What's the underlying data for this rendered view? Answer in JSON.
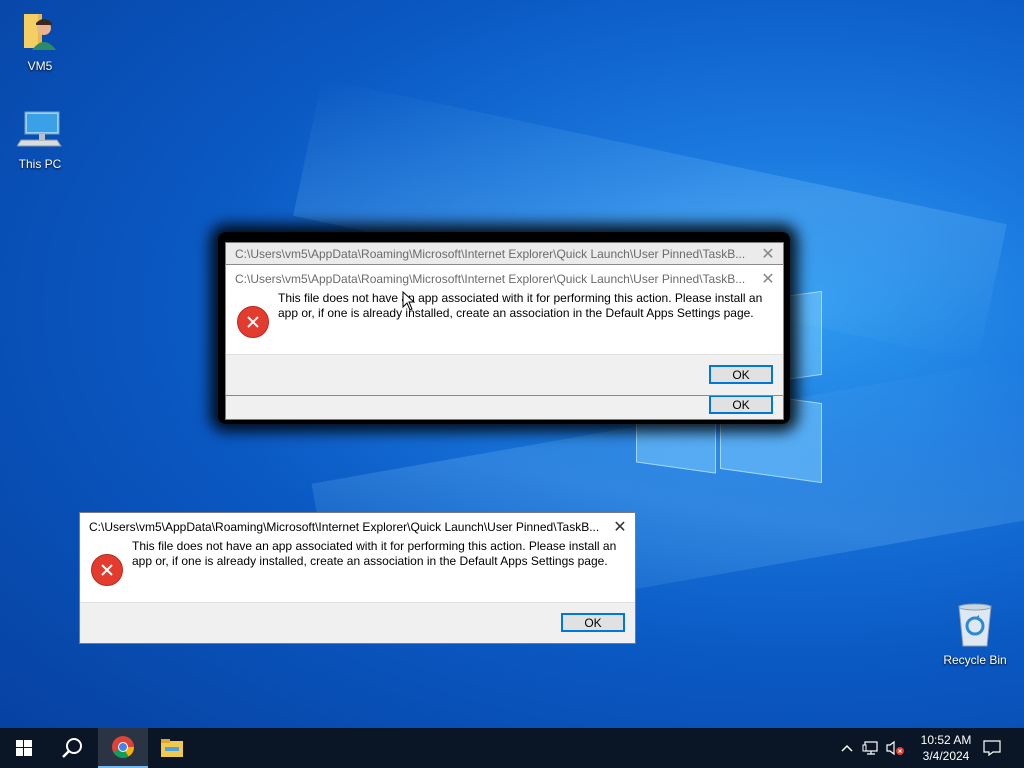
{
  "desktop": {
    "icons": [
      {
        "label": "VM5",
        "icon": "user-folder-icon"
      },
      {
        "label": "This PC",
        "icon": "computer-icon"
      },
      {
        "label": "Recycle Bin",
        "icon": "recycle-bin-icon"
      }
    ]
  },
  "dialogs": {
    "back": {
      "title": "C:\\Users\\vm5\\AppData\\Roaming\\Microsoft\\Internet Explorer\\Quick Launch\\User Pinned\\TaskB...",
      "ok": "OK"
    },
    "front": {
      "title": "C:\\Users\\vm5\\AppData\\Roaming\\Microsoft\\Internet Explorer\\Quick Launch\\User Pinned\\TaskB...",
      "message": "This file does not have an app associated with it for performing this action. Please install an app or, if one is already installed, create an association in the Default Apps Settings page.",
      "ok": "OK"
    },
    "lower": {
      "title": "C:\\Users\\vm5\\AppData\\Roaming\\Microsoft\\Internet Explorer\\Quick Launch\\User Pinned\\TaskB...",
      "message": "This file does not have an app associated with it for performing this action. Please install an app or, if one is already installed, create an association in the Default Apps Settings page.",
      "ok": "OK"
    }
  },
  "taskbar": {
    "items": [
      "start-icon",
      "search-icon",
      "chrome-icon",
      "file-explorer-icon"
    ],
    "tray": [
      "chevron-up-icon",
      "network-icon",
      "volume-muted-icon"
    ],
    "time": "10:52 AM",
    "date": "3/4/2024"
  },
  "colors": {
    "accent": "#0078d7",
    "error": "#e33b2e",
    "taskbar": "#0a1526"
  }
}
